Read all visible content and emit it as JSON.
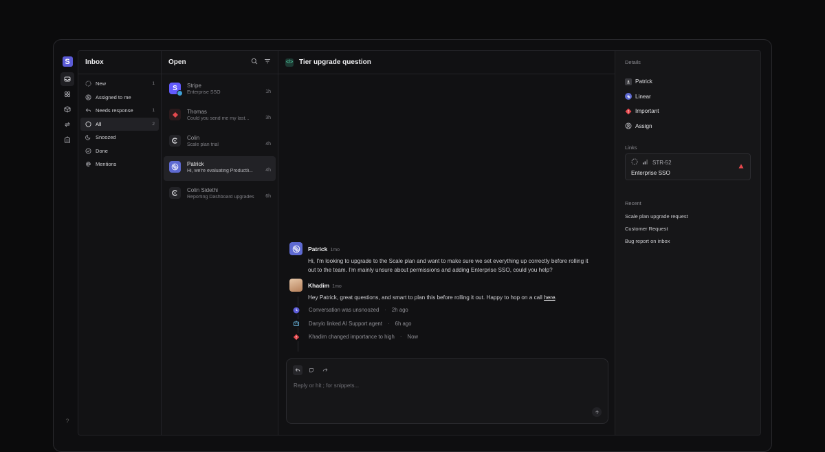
{
  "inbox": {
    "title": "Inbox",
    "items": [
      {
        "label": "New",
        "count": "1",
        "icon": "dashed-circle-icon"
      },
      {
        "label": "Assigned to me",
        "count": "",
        "icon": "user-circle-icon"
      },
      {
        "label": "Needs response",
        "count": "1",
        "icon": "reply-icon"
      },
      {
        "label": "All",
        "count": "2",
        "icon": "circle-icon"
      },
      {
        "label": "Snoozed",
        "count": "",
        "icon": "moon-icon"
      },
      {
        "label": "Done",
        "count": "",
        "icon": "check-circle-icon"
      },
      {
        "label": "Mentions",
        "count": "",
        "icon": "at-icon"
      }
    ]
  },
  "list": {
    "title": "Open",
    "conversations": [
      {
        "name": "Stripe",
        "snippet": "Enterprise SSO",
        "time": "1h",
        "avatar": "stripe",
        "color": "#635bff"
      },
      {
        "name": "Thomas",
        "snippet": "Could you send me my last...",
        "time": "3h",
        "avatar": "thomas",
        "color": "#e5484d"
      },
      {
        "name": "Colin",
        "snippet": "Scale plan trial",
        "time": "4h",
        "avatar": "colin",
        "color": "#2b2b30"
      },
      {
        "name": "Patrick",
        "snippet": "Hi, we're evaluating Productli...",
        "time": "4h",
        "avatar": "patrick",
        "color": "#5e6ad2"
      },
      {
        "name": "Colin Sidethi",
        "snippet": "Reporting Dashboard upgrades",
        "time": "6h",
        "avatar": "colin",
        "color": "#2b2b30"
      }
    ]
  },
  "main": {
    "title": "Tier upgrade question",
    "messages": [
      {
        "author": "Patrick",
        "when": "1mo",
        "body": "Hi, I'm looking to upgrade to the Scale plan and want to make sure we set everything up correctly before rolling it out to the team. I'm mainly unsure about permissions and adding Enterprise SSO, could you help?"
      },
      {
        "author": "Khadim",
        "when": "1mo",
        "body": "Hey Patrick, great questions, and smart to plan this before rolling it out. Happy to hop on a call ",
        "link": "here",
        "tail": "."
      }
    ],
    "events": [
      {
        "text": "Conversation was unsnoozed",
        "when": "2h ago",
        "icon": "clock-icon"
      },
      {
        "text": "Danylo linked AI Support agent",
        "when": "6h ago",
        "icon": "bot-icon"
      },
      {
        "text": "Khadim changed importance to high",
        "when": "Now",
        "icon": "priority-icon"
      }
    ],
    "composer": {
      "placeholder": "Reply or hit ; for snippets..."
    }
  },
  "details": {
    "title": "Details",
    "rows": [
      {
        "label": "Patrick",
        "icon": "person-icon"
      },
      {
        "label": "Linear",
        "icon": "linear-logo-icon"
      },
      {
        "label": "Important",
        "icon": "important-icon"
      },
      {
        "label": "Assign",
        "icon": "assign-icon"
      }
    ],
    "links_title": "Links",
    "link": {
      "id": "STR-52",
      "title": "Enterprise SSO"
    },
    "recent_title": "Recent",
    "recent": [
      "Scale plan upgrade request",
      "Customer Request",
      "Bug report on inbox"
    ]
  },
  "rail": {
    "logo": "S",
    "help": "?"
  },
  "colors": {
    "accent": "#5b5bd6",
    "danger": "#e5484d",
    "bg": "#141416"
  }
}
